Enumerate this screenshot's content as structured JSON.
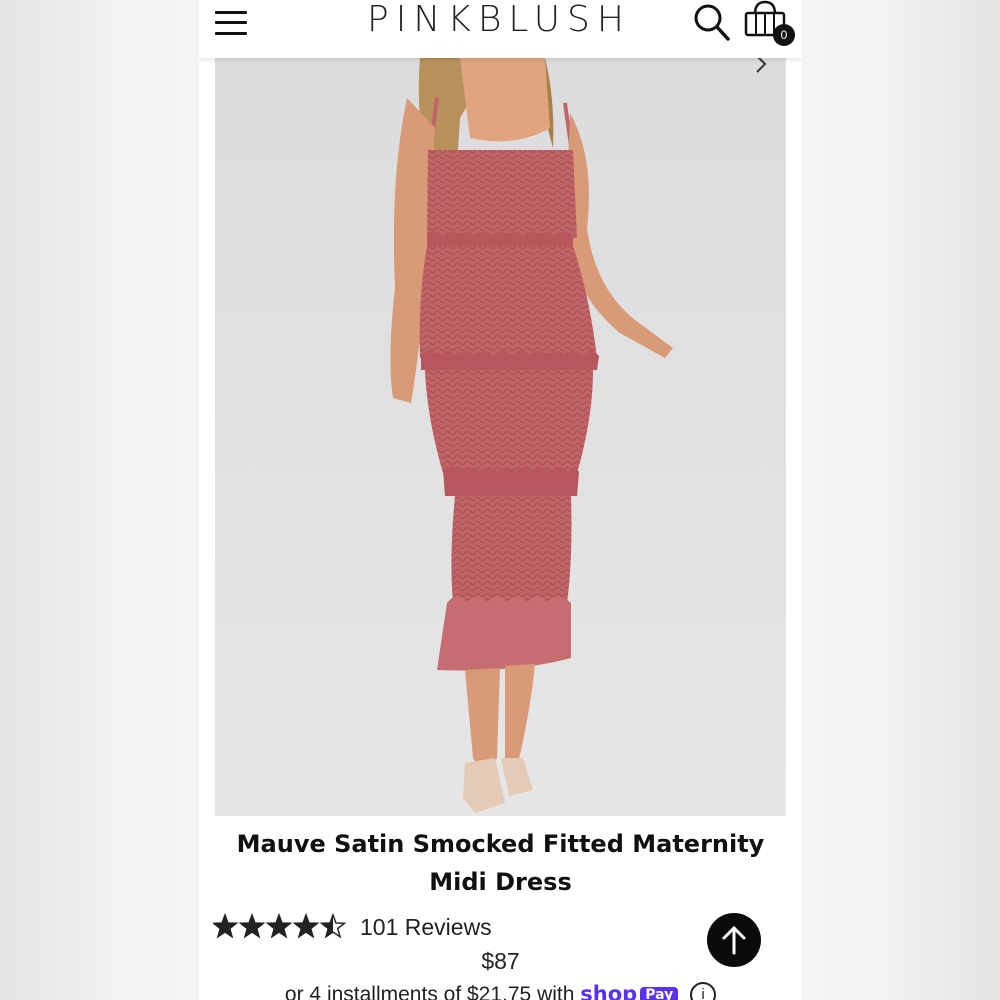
{
  "header": {
    "brand": "PINKBLUSH",
    "cart_count": "0",
    "icons": {
      "menu": "hamburger-icon",
      "search": "search-icon",
      "cart": "shopping-bag-icon"
    }
  },
  "product": {
    "image": "model-in-mauve-smocked-midi-dress",
    "title": "Mauve Satin Smocked Fitted Maternity Midi Dress",
    "rating": 4.5,
    "rating_max": 5,
    "reviews_label": "101 Reviews",
    "price": "$87",
    "installments_text": "or 4 installments of $21.75 with",
    "shop_pay_label": "shop",
    "shop_pay_badge": "Pay",
    "info_label": "i"
  },
  "colors": {
    "dress": "#c06468",
    "photo_background": "#e3e3e5",
    "shop_pay": "#5a31f4"
  }
}
